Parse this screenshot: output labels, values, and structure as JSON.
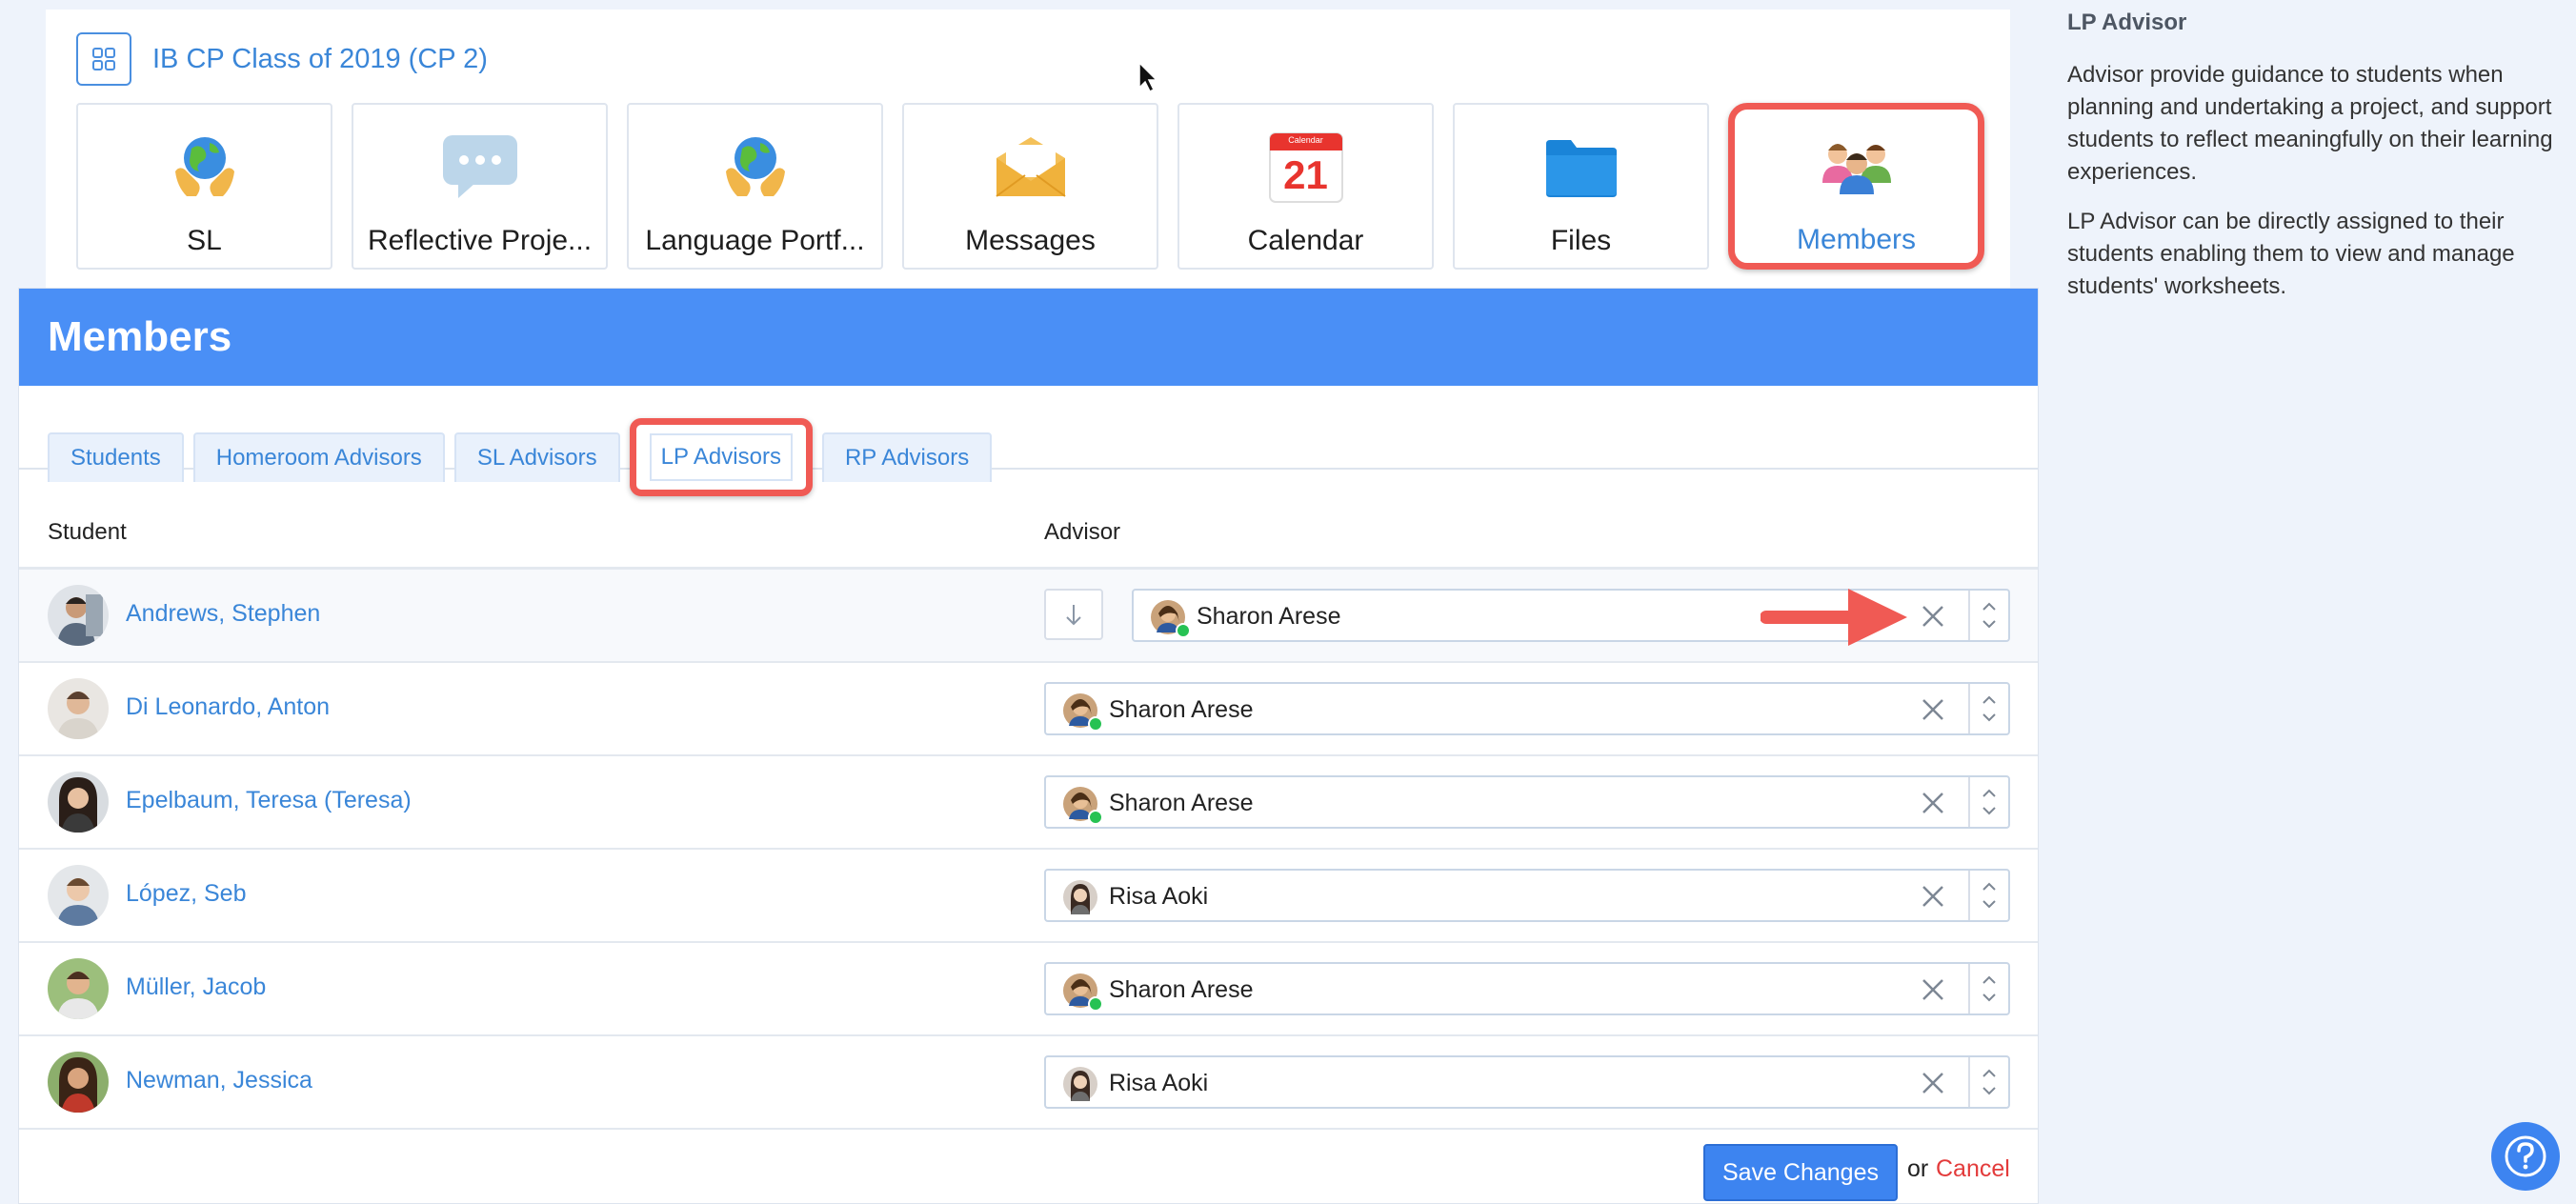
{
  "header": {
    "class_title": "IB CP Class of 2019 (CP 2)"
  },
  "tiles": [
    {
      "label": "SL",
      "icon": "globe-hands-icon"
    },
    {
      "label": "Reflective Proje...",
      "icon": "speech-bubble-icon"
    },
    {
      "label": "Language Portf...",
      "icon": "globe-hands-icon"
    },
    {
      "label": "Messages",
      "icon": "envelope-icon"
    },
    {
      "label": "Calendar",
      "icon": "calendar-icon",
      "calendar_header": "Calendar",
      "calendar_day": "21"
    },
    {
      "label": "Files",
      "icon": "folder-icon"
    },
    {
      "label": "Members",
      "icon": "people-icon",
      "active": true
    }
  ],
  "members": {
    "title": "Members",
    "tabs": [
      {
        "label": "Students"
      },
      {
        "label": "Homeroom Advisors"
      },
      {
        "label": "SL Advisors"
      },
      {
        "label": "LP Advisors",
        "active": true
      },
      {
        "label": "RP Advisors"
      }
    ],
    "columns": {
      "student": "Student",
      "advisor": "Advisor"
    },
    "rows": [
      {
        "student": "Andrews, Stephen",
        "advisor": "Sharon Arese",
        "online": true
      },
      {
        "student": "Di Leonardo, Anton",
        "advisor": "Sharon Arese",
        "online": true
      },
      {
        "student": "Epelbaum, Teresa (Teresa)",
        "advisor": "Sharon Arese",
        "online": true
      },
      {
        "student": "López, Seb",
        "advisor": "Risa Aoki",
        "online": false
      },
      {
        "student": "Müller, Jacob",
        "advisor": "Sharon Arese",
        "online": true
      },
      {
        "student": "Newman, Jessica",
        "advisor": "Risa Aoki",
        "online": false
      }
    ],
    "save_label": "Save Changes",
    "or_label": "or",
    "cancel_label": "Cancel"
  },
  "sidebar": {
    "title": "LP Advisor",
    "para1": "Advisor provide guidance to students when planning and undertaking a project, and support students to reflect meaningfully on their learning experiences.",
    "para2": "LP Advisor can be directly assigned to their students enabling them to view and manage students' worksheets."
  },
  "colors": {
    "accent": "#4a8ff6",
    "link": "#3a86d8",
    "highlight": "#f05a54",
    "online": "#27c253",
    "cancel": "#e33b3b"
  }
}
